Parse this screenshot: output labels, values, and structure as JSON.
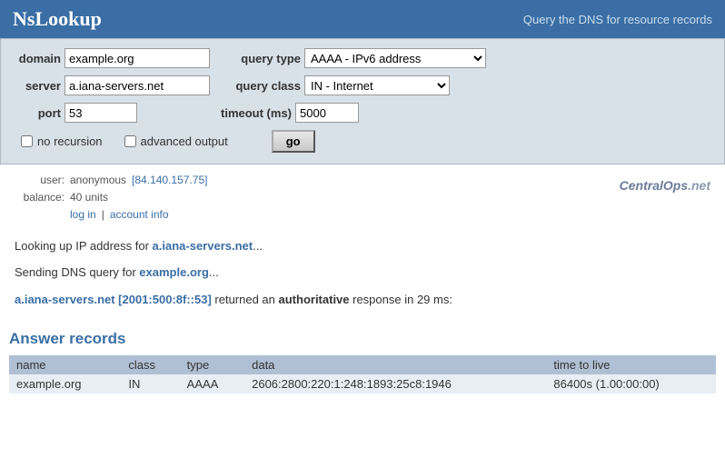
{
  "header": {
    "title": "NsLookup",
    "subtitle": "Query the DNS for resource records"
  },
  "form": {
    "domain_label": "domain",
    "domain_value": "example.org",
    "server_label": "server",
    "server_value": "a.iana-servers.net",
    "port_label": "port",
    "port_value": "53",
    "query_type_label": "query type",
    "query_type_value": "AAAA - IPv6 address",
    "query_class_label": "query class",
    "query_class_value": "IN - Internet",
    "timeout_label": "timeout (ms)",
    "timeout_value": "5000",
    "no_recursion_label": "no recursion",
    "advanced_output_label": "advanced output",
    "go_label": "go"
  },
  "user": {
    "user_label": "user:",
    "user_value": "anonymous",
    "user_ip": "[84.140.157.75]",
    "balance_label": "balance:",
    "balance_value": "40 units",
    "login_label": "log in",
    "account_label": "account info"
  },
  "centralops_logo": "CentralOps.net",
  "output": {
    "line1_prefix": "Looking up IP address for ",
    "line1_link": "a.iana-servers.net",
    "line1_suffix": "...",
    "line2_prefix": "Sending DNS query for ",
    "line2_link": "example.org",
    "line2_suffix": "...",
    "line3_link1": "a.iana-servers.net [2001:500:8f::53]",
    "line3_mid": " returned an ",
    "line3_bold": "authoritative",
    "line3_suffix": " response in 29 ms:"
  },
  "answer_records": {
    "title": "Answer records",
    "columns": [
      "name",
      "class",
      "type",
      "data",
      "time to live"
    ],
    "rows": [
      {
        "name": "example.org",
        "class": "IN",
        "type": "AAAA",
        "data": "2606:2800:220:1:248:1893:25c8:1946",
        "ttl": "86400s  (1.00:00:00)"
      }
    ]
  }
}
